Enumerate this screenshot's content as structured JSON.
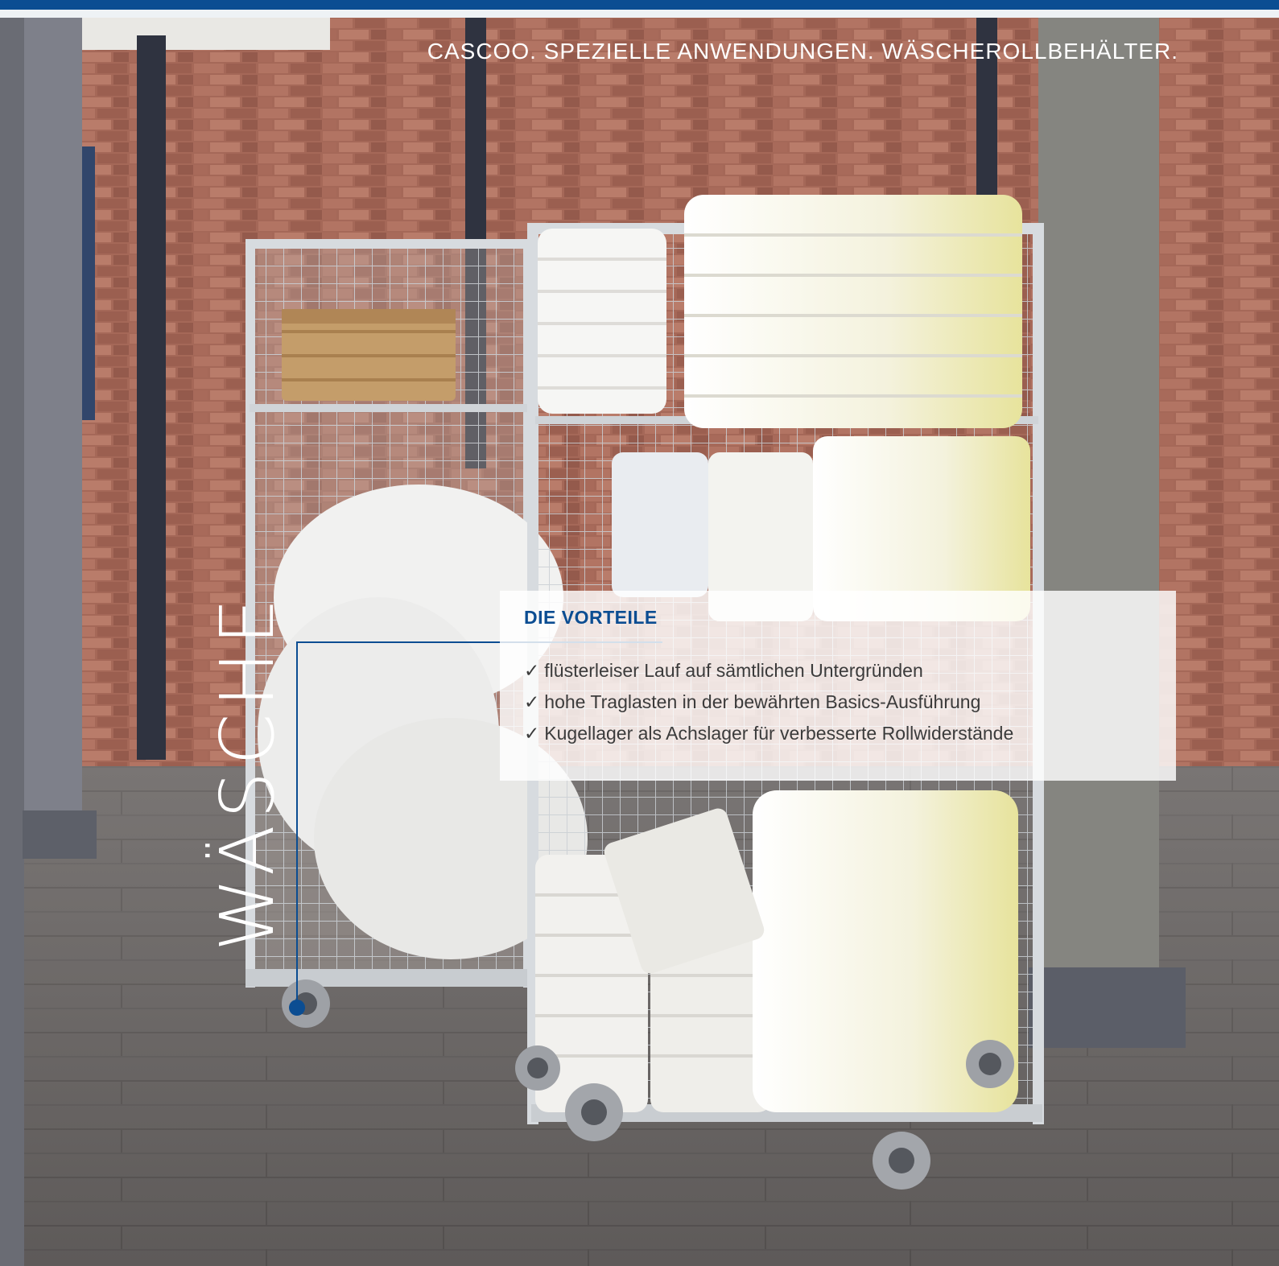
{
  "header": {
    "breadcrumb": "CASCOO. SPEZIELLE ANWENDUNGEN. WÄSCHEROLLBEHÄLTER."
  },
  "side_title": "WÄSCHE",
  "benefits": {
    "title": "DIE VORTEILE",
    "check_symbol": "✓",
    "items": [
      "flüsterleiser Lauf auf sämtlichen Untergründen",
      "hohe Traglasten in der bewährten Basics-Ausführung",
      "Kugellager als Achslager für verbesserte Rollwiderstände"
    ]
  },
  "colors": {
    "accent": "#0b4d92",
    "brick": "#9a6153",
    "floor": "#6f6b6a"
  }
}
